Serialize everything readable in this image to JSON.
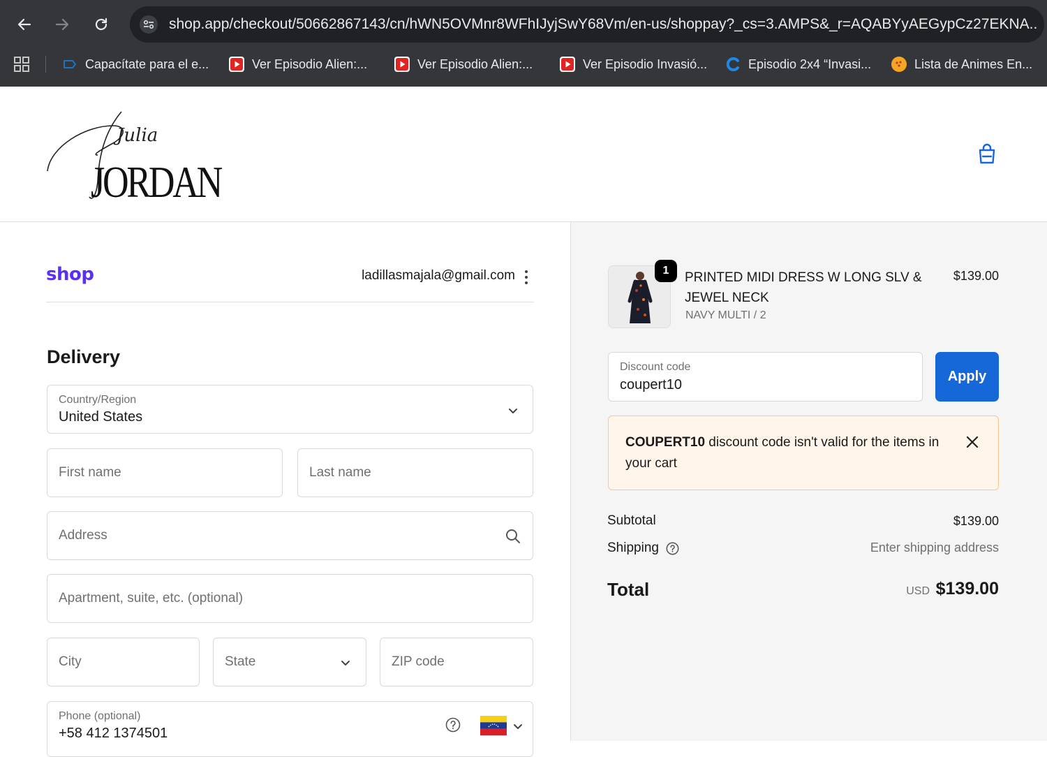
{
  "browser": {
    "url": "shop.app/checkout/50662867143/cn/hWN5OVMnr8WFhIJyjSwY68Vm/en-us/shoppay?_cs=3.AMPS&_r=AQABYyAEGypCz27EKNA...",
    "bookmarks": [
      {
        "label": "Capacítate para el e...",
        "icon": "capacitate-icon"
      },
      {
        "label": "Ver Episodio Alien:...",
        "icon": "video-play-icon"
      },
      {
        "label": "Ver Episodio Alien:...",
        "icon": "video-play-icon"
      },
      {
        "label": "Ver Episodio Invasió...",
        "icon": "video-play-icon"
      },
      {
        "label": "Episodio 2x4 “Invasi...",
        "icon": "c-logo-icon"
      },
      {
        "label": "Lista de Animes En...",
        "icon": "dragonball-icon"
      }
    ]
  },
  "store": {
    "logo_script": "Julia",
    "logo_text": "JORDAN"
  },
  "account": {
    "provider_logo": "shop",
    "email": "ladillasmajala@gmail.com"
  },
  "delivery": {
    "title": "Delivery",
    "country_label": "Country/Region",
    "country_value": "United States",
    "first_name_placeholder": "First name",
    "last_name_placeholder": "Last name",
    "address_placeholder": "Address",
    "apartment_placeholder": "Apartment, suite, etc. (optional)",
    "city_placeholder": "City",
    "state_placeholder": "State",
    "zip_placeholder": "ZIP code",
    "phone_label": "Phone (optional)",
    "phone_value": "+58 412 1374501"
  },
  "summary": {
    "item": {
      "quantity": "1",
      "name": "PRINTED MIDI DRESS W LONG SLV & JEWEL NECK",
      "variant": "NAVY MULTI / 2",
      "price": "$139.00"
    },
    "discount": {
      "label": "Discount code",
      "value": "coupert10",
      "apply_label": "Apply"
    },
    "alert": {
      "code": "COUPERT10",
      "message": " discount code isn't valid for the items in your cart"
    },
    "subtotal_label": "Subtotal",
    "subtotal_value": "$139.00",
    "shipping_label": "Shipping",
    "shipping_value": "Enter shipping address",
    "total_label": "Total",
    "total_currency": "USD",
    "total_value": "$139.00"
  },
  "colors": {
    "shop_brand": "#5a31f4",
    "apply_button": "#1668d9",
    "alert_background": "#fff5ea",
    "alert_border": "#f7c894"
  }
}
